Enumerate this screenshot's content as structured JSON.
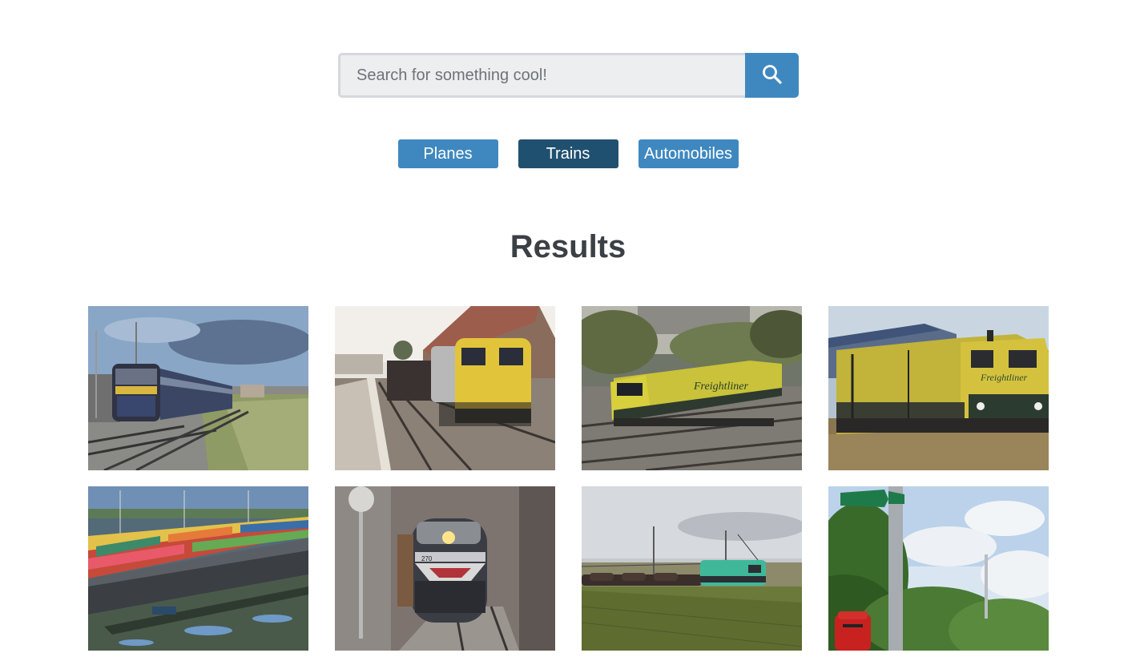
{
  "search": {
    "placeholder": "Search for something cool!",
    "value": "",
    "button_icon": "search-icon"
  },
  "categories": [
    {
      "label": "Planes",
      "active": false
    },
    {
      "label": "Trains",
      "active": true
    },
    {
      "label": "Automobiles",
      "active": false
    }
  ],
  "results": {
    "title": "Results",
    "items": [
      {
        "subject": "blue-yellow-passenger-train"
      },
      {
        "subject": "yellow-grey-diesel-locomotive-platform"
      },
      {
        "subject": "freightliner-locomotive-green-trees"
      },
      {
        "subject": "freightliner-locomotive-shed"
      },
      {
        "subject": "container-terminal-train"
      },
      {
        "subject": "vintage-diesel-locomotive-snow"
      },
      {
        "subject": "tanker-freight-train-field"
      },
      {
        "subject": "signpost-hedge-postbox"
      }
    ]
  },
  "colors": {
    "primary": "#3f88bf",
    "active": "#20506f",
    "heading": "#3b4045"
  }
}
